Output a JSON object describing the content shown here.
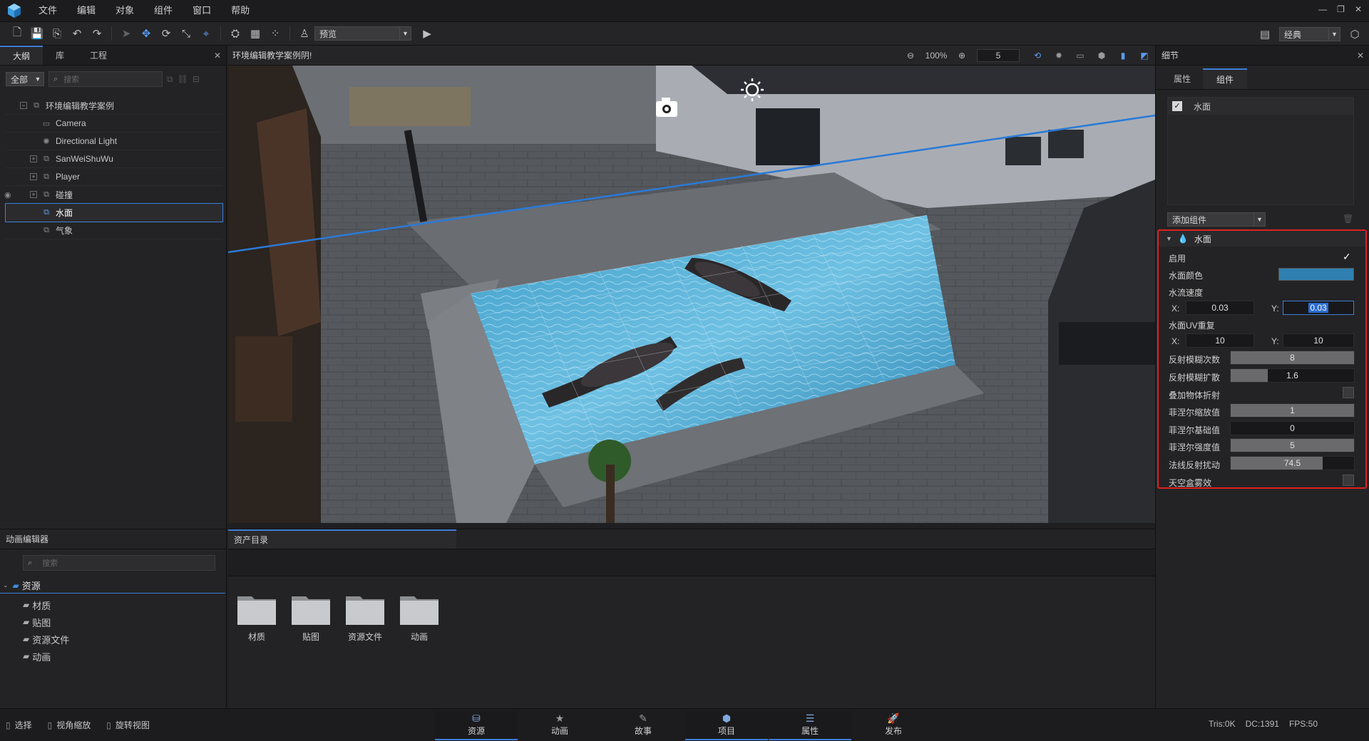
{
  "menu": [
    "文件",
    "编辑",
    "对象",
    "组件",
    "窗口",
    "帮助"
  ],
  "window_controls": [
    "—",
    "❐",
    "✕"
  ],
  "toolbar": {
    "mode_select": "预览",
    "layout_select": "经典"
  },
  "left": {
    "tabs": [
      "大纲",
      "库",
      "工程"
    ],
    "filter": "全部",
    "search_placeholder": "搜索",
    "tree": [
      {
        "label": "环境编辑教学案例",
        "icon": "scene-icon"
      },
      {
        "label": "Camera",
        "icon": "camera-icon"
      },
      {
        "label": "Directional Light",
        "icon": "light-icon"
      },
      {
        "label": "SanWeiShuWu",
        "icon": "object-icon"
      },
      {
        "label": "Player",
        "icon": "object-icon"
      },
      {
        "label": "碰撞",
        "icon": "object-icon"
      },
      {
        "label": "水面",
        "icon": "object-icon"
      },
      {
        "label": "气象",
        "icon": "object-icon"
      }
    ]
  },
  "viewport": {
    "title": "环境编辑教学案例阴!",
    "zoom": "100%",
    "speed": "5"
  },
  "details": {
    "title": "细节",
    "tabs": [
      "属性",
      "组件"
    ],
    "component_item": "水面",
    "add_component": "添加组件",
    "section": "水面",
    "enable_label": "启用",
    "water_color_label": "水面颜色",
    "water_color": "#2f7fb0",
    "flow_speed_label": "水流速度",
    "flow_x_label": "X:",
    "flow_x": "0.03",
    "flow_y_label": "Y:",
    "flow_y": "0.03",
    "uv_label": "水面UV重复",
    "uv_x_label": "X:",
    "uv_x": "10",
    "uv_y_label": "Y:",
    "uv_y": "10",
    "blur_count_label": "反射模糊次数",
    "blur_count": "8",
    "blur_count_fill": 1.0,
    "blur_spread_label": "反射模糊扩散",
    "blur_spread": "1.6",
    "blur_spread_fill": 0.3,
    "refraction_label": "叠加物体折射",
    "fresnel_scale_label": "菲涅尔缩放值",
    "fresnel_scale": "1",
    "fresnel_scale_fill": 1.0,
    "fresnel_base_label": "菲涅尔基础值",
    "fresnel_base": "0",
    "fresnel_base_fill": 0.0,
    "fresnel_power_label": "菲涅尔强度值",
    "fresnel_power": "5",
    "fresnel_power_fill": 1.0,
    "normal_label": "法线反射扰动",
    "normal": "74.5",
    "normal_fill": 0.745,
    "skybox_label": "天空盒雾效"
  },
  "anim": {
    "title": "动画编辑器",
    "search_placeholder": "搜索",
    "root": "资源",
    "children": [
      "材质",
      "贴图",
      "资源文件",
      "动画"
    ]
  },
  "assets": {
    "tab": "资产目录",
    "folders": [
      "材质",
      "贴图",
      "资源文件",
      "动画"
    ]
  },
  "status": {
    "left_items": [
      "选择",
      "视角缩放",
      "旋转视图"
    ],
    "tabs": [
      "资源",
      "动画",
      "故事",
      "项目",
      "属性",
      "发布"
    ],
    "tris": "Tris:0K",
    "dc": "DC:1391",
    "fps": "FPS:50"
  },
  "colors": {
    "accent": "#3d7ed8",
    "highlight_border": "#e02020"
  }
}
